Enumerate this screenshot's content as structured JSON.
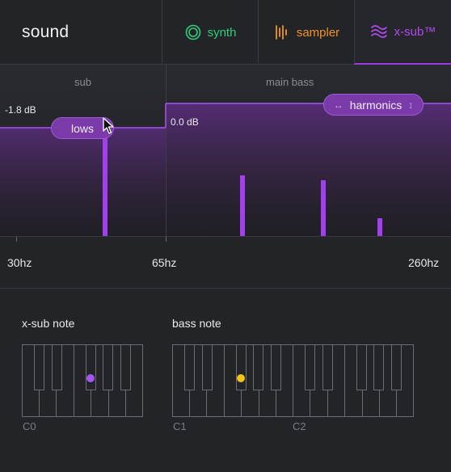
{
  "header": {
    "title": "sound",
    "tabs": [
      {
        "label": "synth",
        "icon": "synth-icon",
        "color": "#2ecf7a"
      },
      {
        "label": "sampler",
        "icon": "sampler-icon",
        "color": "#f29324"
      },
      {
        "label": "x-sub™",
        "icon": "wave-icon",
        "color": "#b04cf0",
        "active": true
      }
    ]
  },
  "graph": {
    "sub_label": "sub",
    "main_label": "main bass",
    "sub_level": "-1.8 dB",
    "main_level": "0.0 dB",
    "lows_label": "lows",
    "harmonics_label": "harmonics",
    "accent_color": "#a855f7"
  },
  "axis": {
    "hz_30": "30hz",
    "hz_65": "65hz",
    "hz_260": "260hz"
  },
  "notes": {
    "xsub_title": "x-sub note",
    "bass_title": "bass note",
    "c0": "C0",
    "c1": "C1",
    "c2": "C2",
    "xsub_dot_color": "#a855f7",
    "bass_dot_color": "#f2c418"
  }
}
